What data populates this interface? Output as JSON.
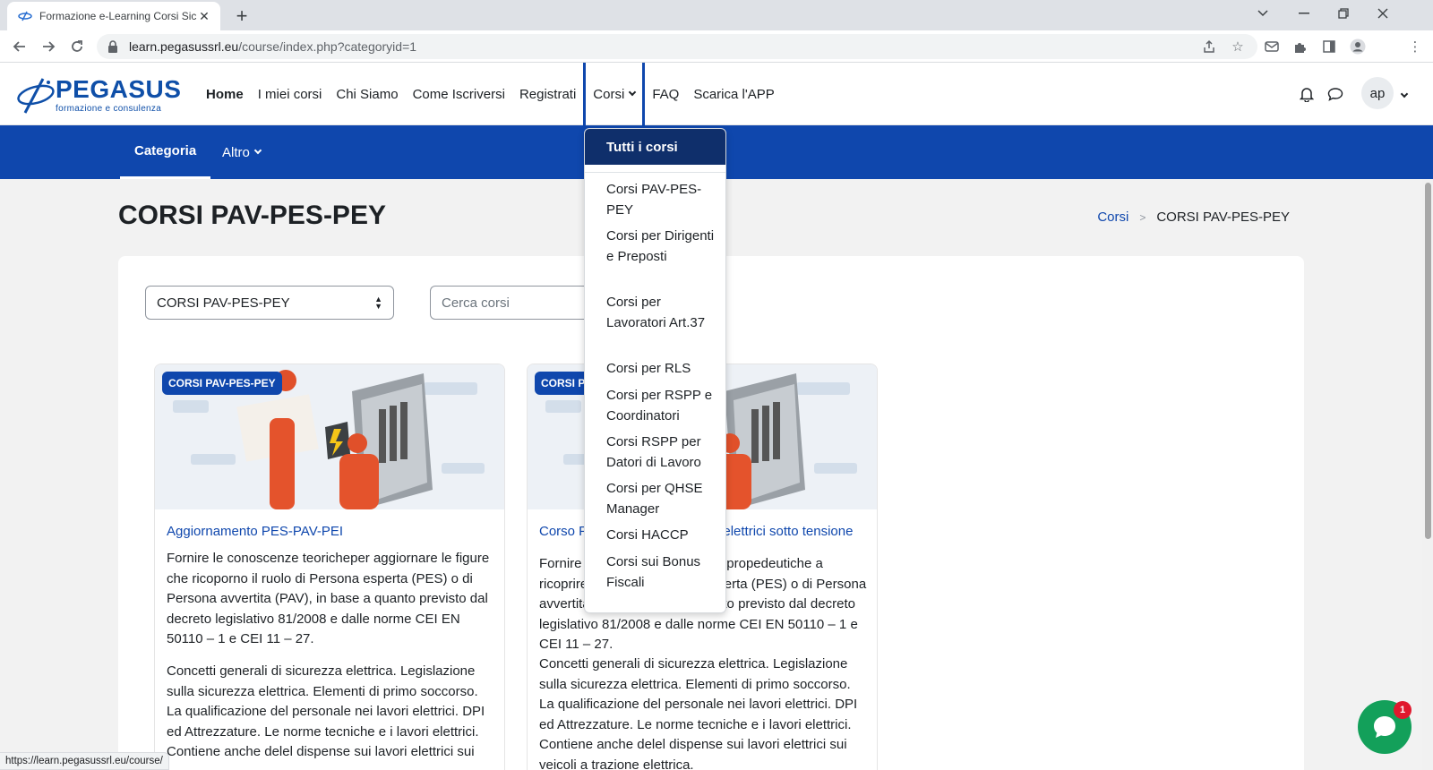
{
  "browser": {
    "tab_title": "Formazione e-Learning Corsi Sicu",
    "url_host": "learn.pegasussrl.eu",
    "url_path": "/course/index.php?categoryid=1",
    "status_url": "https://learn.pegasussrl.eu/course/"
  },
  "brand": {
    "name": "PEGASUS",
    "tagline": "formazione e consulenza",
    "color": "#0f47ad"
  },
  "nav": {
    "items": [
      "Home",
      "I miei corsi",
      "Chi Siamo",
      "Come Iscriversi",
      "Registrati",
      "Corsi",
      "FAQ",
      "Scarica l'APP"
    ],
    "user_initials": "ap"
  },
  "secondary_nav": {
    "categoria": "Categoria",
    "altro": "Altro"
  },
  "page": {
    "title": "CORSI PAV-PES-PEY",
    "breadcrumb": [
      "Corsi",
      "CORSI PAV-PES-PEY"
    ]
  },
  "filters": {
    "category_select": "CORSI PAV-PES-PEY",
    "search_placeholder": "Cerca corsi"
  },
  "courses": [
    {
      "badge": "CORSI PAV-PES-PEY",
      "title": "Aggiornamento PES-PAV-PEI",
      "desc1": "Fornire le conoscenze teoricheper aggiornare le figure che ricoporno il ruolo di Persona esperta (PES) o di Persona avvertita (PAV), in base a quanto previsto dal decreto legislativo 81/2008 e dalle norme CEI EN 50110 – 1 e CEI 11 – 27.",
      "desc2": "Concetti generali di sicurezza elettrica. Legislazione sulla sicurezza elettrica. Elementi di primo soccorso. La qualificazione del personale nei lavori elettrici. DPI ed Attrezzature. Le norme tecniche e i lavori elettrici. Contiene anche delel dispense sui lavori elettrici sui"
    },
    {
      "badge": "CORSI PAV-PES-PEY",
      "title": "Corso PES-PAV-PEI per lavori elettrici sotto tensione",
      "desc1": "Fornire le conoscenze teoriche propedeutiche a ricoprire il ruolo di Persona esperta (PES) o di Persona avvertita (PAV), in base a quanto previsto dal decreto legislativo 81/2008 e dalle norme CEI EN 50110 – 1 e CEI 11 – 27.",
      "desc2": "Concetti generali di sicurezza elettrica. Legislazione sulla sicurezza elettrica. Elementi di primo soccorso. La qualificazione del personale nei lavori elettrici. DPI ed Attrezzature. Le norme tecniche e i lavori elettrici. Contiene anche delel dispense sui lavori elettrici sui veicoli a trazione elettrica."
    }
  ],
  "dropdown": {
    "active": "Tutti i corsi",
    "items": [
      "Corsi PAV-PES-PEY",
      "Corsi per Dirigenti e Preposti",
      "Corsi per Lavoratori Art.37",
      "Corsi per RLS",
      "Corsi per RSPP e Coordinatori",
      "Corsi RSPP per Datori di Lavoro",
      "Corsi per QHSE Manager",
      "Corsi HACCP",
      "Corsi sui Bonus Fiscali"
    ]
  },
  "chat": {
    "unread": "1",
    "color": "#13a05a"
  }
}
